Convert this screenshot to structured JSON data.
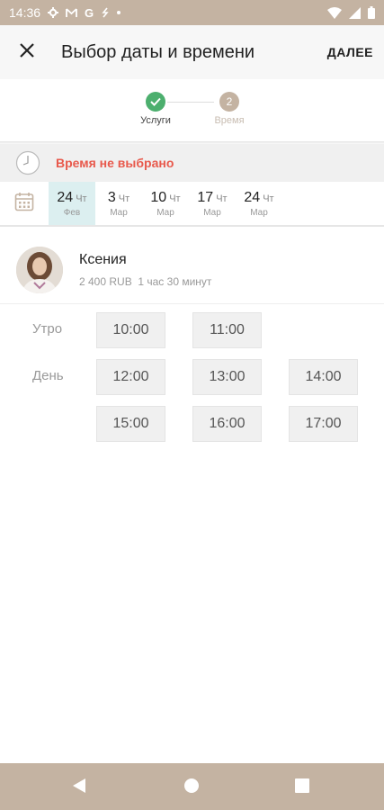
{
  "status_bar": {
    "time": "14:36",
    "left_icons": [
      "gear-icon",
      "gmail-icon",
      "google-icon",
      "sync-icon",
      "dot-icon"
    ],
    "right_icons": [
      "wifi-icon",
      "signal-icon",
      "battery-icon"
    ]
  },
  "app_bar": {
    "title": "Выбор даты и времени",
    "next_label": "ДАЛЕЕ"
  },
  "stepper": {
    "steps": [
      {
        "label": "Услуги",
        "state": "done"
      },
      {
        "label": "Время",
        "number": "2",
        "state": "current"
      }
    ]
  },
  "banner": {
    "text": "Время не выбрано"
  },
  "dates": [
    {
      "day": "24",
      "dow": "Чт",
      "month": "Фев",
      "selected": true
    },
    {
      "day": "3",
      "dow": "Чт",
      "month": "Мар",
      "selected": false
    },
    {
      "day": "10",
      "dow": "Чт",
      "month": "Мар",
      "selected": false
    },
    {
      "day": "17",
      "dow": "Чт",
      "month": "Мар",
      "selected": false
    },
    {
      "day": "24",
      "dow": "Чт",
      "month": "Мар",
      "selected": false
    }
  ],
  "staff": {
    "name": "Ксения",
    "price": "2 400 RUB",
    "duration": "1 час 30 минут"
  },
  "schedule": {
    "morning_label": "Утро",
    "day_label": "День",
    "morning_slots": [
      "10:00",
      "11:00"
    ],
    "day_slots": [
      "12:00",
      "13:00",
      "14:00",
      "15:00",
      "16:00",
      "17:00"
    ]
  },
  "colors": {
    "accent_bar": "#c4b3a2",
    "success": "#4caf6e",
    "warning_text": "#e8594c",
    "selected_date_bg": "#dceff0"
  }
}
